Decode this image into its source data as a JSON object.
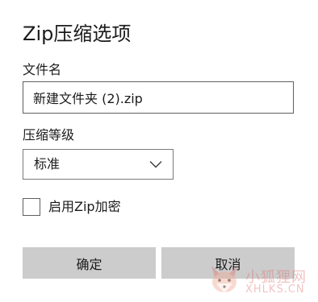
{
  "dialog": {
    "title": "Zip压缩选项",
    "filename_label": "文件名",
    "filename_value": "新建文件夹 (2).zip",
    "level_label": "压缩等级",
    "level_value": "标准",
    "encrypt_label": "启用Zip加密",
    "encrypt_checked": false,
    "ok_label": "确定",
    "cancel_label": "取消"
  },
  "watermark": {
    "text": "小狐狸网",
    "sub": "XHLKS.CN",
    "color": "#e07878"
  },
  "icons": {
    "chevron": "chevron-down-icon",
    "logo": "fox-logo-icon"
  }
}
